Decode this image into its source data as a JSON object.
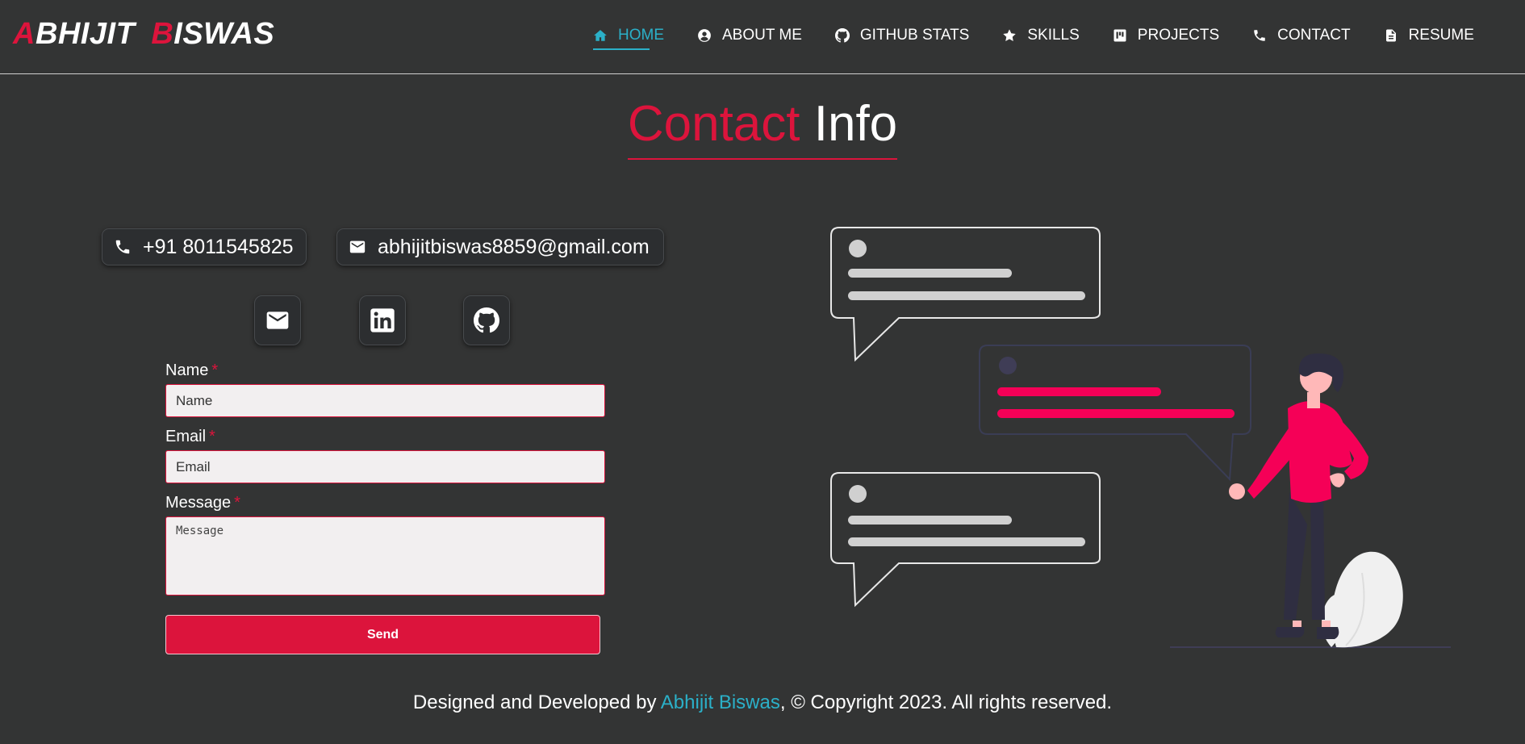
{
  "brand": {
    "first_initial": "A",
    "first_rest": "BHIJIT",
    "last_initial": "B",
    "last_rest": "ISWAS"
  },
  "nav": {
    "items": [
      {
        "label": "HOME",
        "icon": "home-icon",
        "active": true
      },
      {
        "label": "ABOUT ME",
        "icon": "user-circle-icon"
      },
      {
        "label": "GITHUB STATS",
        "icon": "github-icon"
      },
      {
        "label": "SKILLS",
        "icon": "star-icon"
      },
      {
        "label": "PROJECTS",
        "icon": "kanban-board-icon"
      },
      {
        "label": "CONTACT",
        "icon": "phone-icon"
      },
      {
        "label": "RESUME",
        "icon": "document-icon"
      }
    ]
  },
  "section": {
    "title_accent": "Contact",
    "title_rest": "Info"
  },
  "contact": {
    "phone": "+91 8011545825",
    "email": "abhijitbiswas8859@gmail.com"
  },
  "social": [
    {
      "icon": "envelope-icon"
    },
    {
      "icon": "linkedin-icon"
    },
    {
      "icon": "github-icon"
    }
  ],
  "form": {
    "name_label": "Name",
    "name_placeholder": "Name",
    "email_label": "Email",
    "email_placeholder": "Email",
    "message_label": "Message",
    "message_placeholder": "Message",
    "required_mark": "*",
    "send_label": "Send"
  },
  "footer": {
    "prefix": "Designed and Developed by ",
    "author": "Abhijit Biswas",
    "suffix": ", © Copyright 2023. All rights reserved."
  },
  "colors": {
    "background": "#333434",
    "accent": "#dc143c",
    "link": "#2bb0c8",
    "illustration_pink": "#f50057"
  }
}
